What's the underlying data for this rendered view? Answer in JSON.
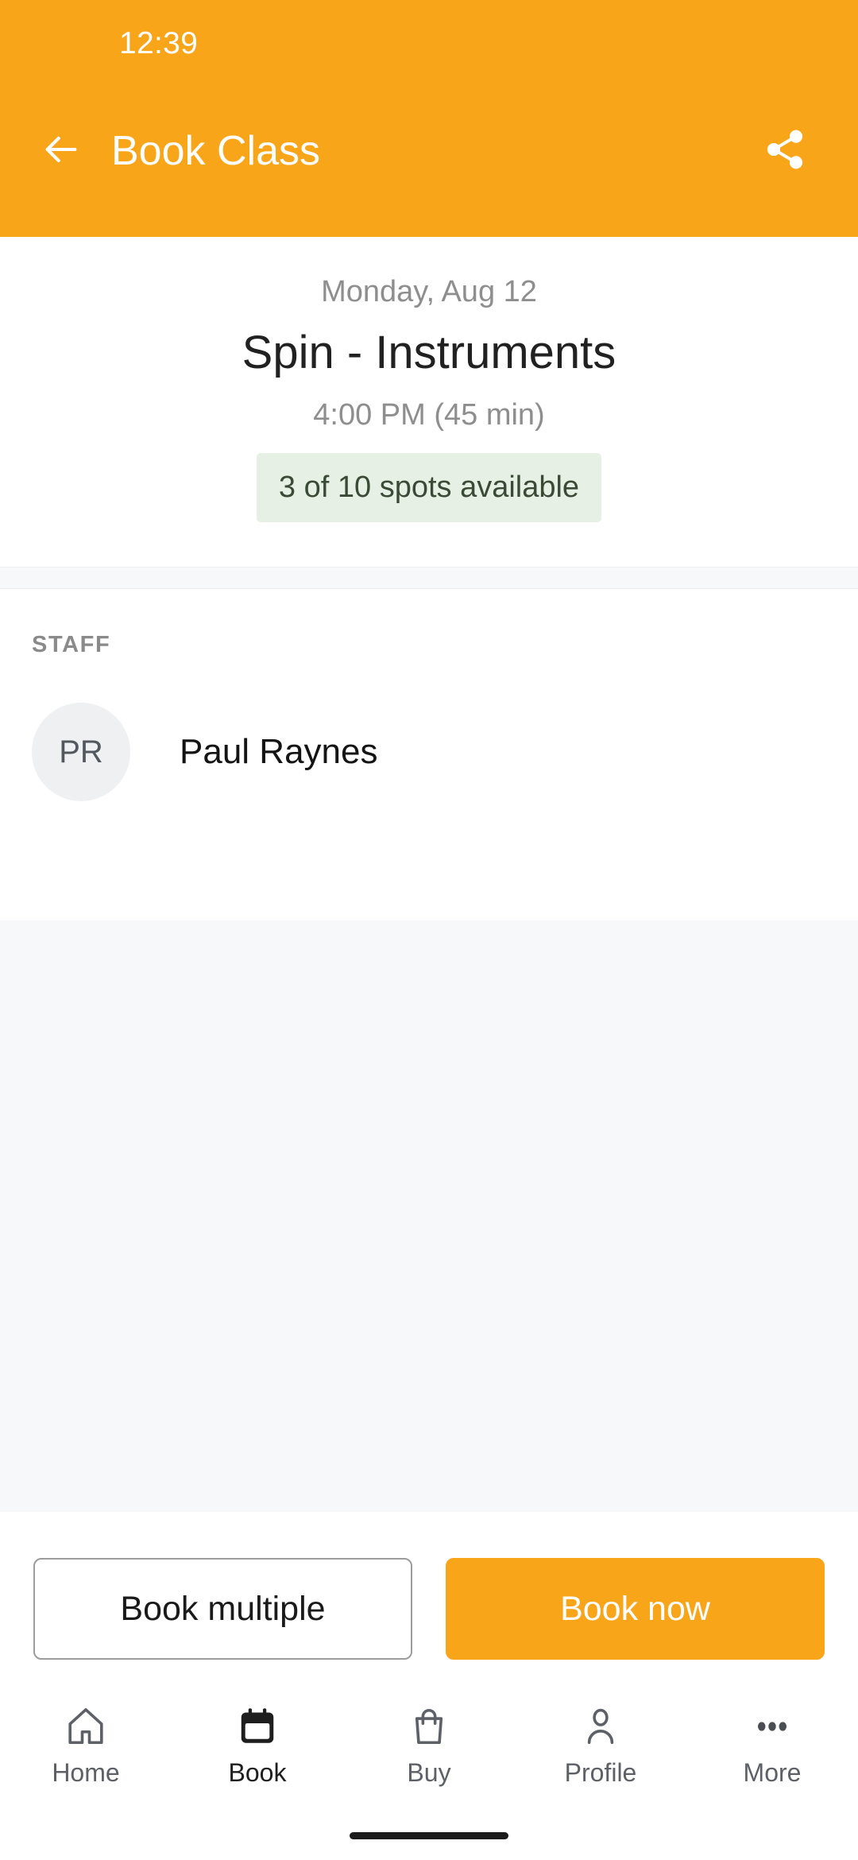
{
  "status_bar": {
    "time": "12:39"
  },
  "app_bar": {
    "title": "Book Class",
    "back_icon": "arrow-left-icon",
    "share_icon": "share-icon",
    "background_color": "#f9a51a"
  },
  "class_summary": {
    "date": "Monday, Aug 12",
    "name": "Spin - Instruments",
    "time_and_duration": "4:00 PM (45 min)",
    "spots_available": "3 of 10 spots available",
    "spots_badge_bg": "#e6f0e4",
    "spots_badge_text_color": "#3a4a37"
  },
  "staff_section": {
    "label": "STAFF",
    "members": [
      {
        "initials": "PR",
        "name": "Paul Raynes"
      }
    ]
  },
  "actions": {
    "secondary_label": "Book multiple",
    "primary_label": "Book now",
    "primary_color": "#f9a51a"
  },
  "bottom_nav": {
    "items": [
      {
        "label": "Home",
        "icon": "home-icon",
        "active": false
      },
      {
        "label": "Book",
        "icon": "calendar-icon",
        "active": true
      },
      {
        "label": "Buy",
        "icon": "shopping-bag-icon",
        "active": false
      },
      {
        "label": "Profile",
        "icon": "person-icon",
        "active": false
      },
      {
        "label": "More",
        "icon": "ellipsis-icon",
        "active": false
      }
    ]
  }
}
